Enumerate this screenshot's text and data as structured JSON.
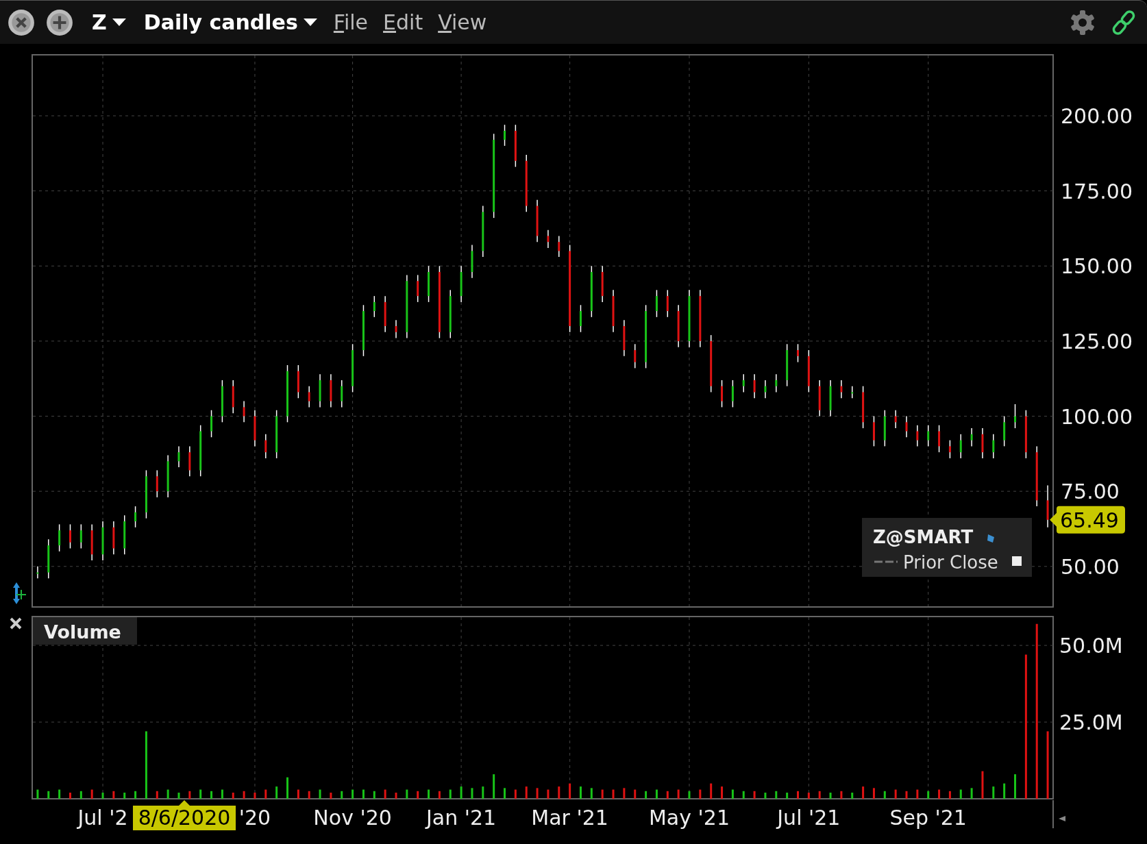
{
  "toolbar": {
    "symbol": "Z",
    "chart_type": "Daily candles",
    "menu": [
      "File",
      "Edit",
      "View"
    ]
  },
  "price_panel": {
    "legend": {
      "symbol": "Z@SMART",
      "prior_close_label": "Prior Close"
    },
    "last_price_tag": "65.49",
    "chart_data": {
      "type": "candlestick",
      "grid": true,
      "categories": [
        null,
        null,
        null,
        null,
        null,
        null,
        null,
        null,
        null,
        null,
        null,
        null,
        null,
        null,
        null,
        null,
        null,
        null,
        null,
        null,
        null,
        null,
        null,
        null,
        null,
        null,
        null,
        null,
        null,
        null,
        null,
        null,
        null,
        null,
        null,
        null,
        null,
        null,
        null,
        null,
        null,
        null,
        null,
        null,
        null,
        null,
        null,
        null,
        null,
        null,
        null,
        null,
        null,
        null,
        null,
        null,
        null,
        null,
        null,
        null,
        null,
        null,
        null,
        null,
        null,
        null,
        null,
        null,
        null,
        null,
        null,
        null,
        null,
        null,
        null,
        null,
        null,
        null,
        null,
        null,
        null,
        null,
        null,
        null,
        null,
        null,
        null,
        null,
        null,
        null,
        null,
        null,
        null,
        null
      ],
      "ohlc": [
        [
          48,
          50,
          46,
          48
        ],
        [
          48,
          59,
          46,
          57
        ],
        [
          57,
          64,
          55,
          62
        ],
        [
          62,
          64,
          56,
          58
        ],
        [
          58,
          64,
          56,
          62
        ],
        [
          62,
          64,
          52,
          54
        ],
        [
          54,
          65,
          52,
          63
        ],
        [
          63,
          65,
          54,
          56
        ],
        [
          56,
          67,
          54,
          65
        ],
        [
          65,
          70,
          63,
          68
        ],
        [
          68,
          82,
          66,
          80
        ],
        [
          80,
          82,
          73,
          75
        ],
        [
          75,
          87,
          73,
          85
        ],
        [
          85,
          90,
          83,
          88
        ],
        [
          88,
          90,
          80,
          82
        ],
        [
          82,
          97,
          80,
          95
        ],
        [
          95,
          102,
          93,
          100
        ],
        [
          100,
          112,
          98,
          110
        ],
        [
          110,
          112,
          101,
          103
        ],
        [
          103,
          105,
          98,
          100
        ],
        [
          100,
          102,
          90,
          92
        ],
        [
          92,
          94,
          86,
          88
        ],
        [
          88,
          102,
          86,
          100
        ],
        [
          100,
          117,
          98,
          115
        ],
        [
          115,
          117,
          106,
          108
        ],
        [
          108,
          110,
          103,
          105
        ],
        [
          105,
          114,
          103,
          112
        ],
        [
          112,
          114,
          103,
          105
        ],
        [
          105,
          112,
          103,
          110
        ],
        [
          110,
          124,
          108,
          122
        ],
        [
          122,
          137,
          120,
          135
        ],
        [
          135,
          140,
          133,
          138
        ],
        [
          138,
          140,
          128,
          130
        ],
        [
          130,
          132,
          126,
          128
        ],
        [
          128,
          147,
          126,
          145
        ],
        [
          145,
          147,
          138,
          140
        ],
        [
          140,
          150,
          138,
          148
        ],
        [
          148,
          150,
          126,
          128
        ],
        [
          128,
          142,
          126,
          140
        ],
        [
          140,
          150,
          138,
          148
        ],
        [
          148,
          157,
          146,
          155
        ],
        [
          155,
          170,
          153,
          168
        ],
        [
          168,
          194,
          166,
          192
        ],
        [
          192,
          197,
          190,
          195
        ],
        [
          195,
          197,
          183,
          185
        ],
        [
          185,
          187,
          168,
          170
        ],
        [
          170,
          172,
          158,
          160
        ],
        [
          160,
          162,
          156,
          158
        ],
        [
          158,
          160,
          153,
          155
        ],
        [
          155,
          157,
          128,
          130
        ],
        [
          130,
          137,
          128,
          135
        ],
        [
          135,
          150,
          133,
          148
        ],
        [
          148,
          150,
          138,
          140
        ],
        [
          140,
          142,
          128,
          130
        ],
        [
          130,
          132,
          120,
          122
        ],
        [
          122,
          124,
          116,
          118
        ],
        [
          118,
          137,
          116,
          135
        ],
        [
          135,
          142,
          133,
          140
        ],
        [
          140,
          142,
          133,
          135
        ],
        [
          135,
          137,
          123,
          125
        ],
        [
          125,
          142,
          123,
          140
        ],
        [
          140,
          142,
          123,
          125
        ],
        [
          125,
          127,
          108,
          110
        ],
        [
          110,
          112,
          103,
          105
        ],
        [
          105,
          112,
          103,
          110
        ],
        [
          110,
          114,
          108,
          112
        ],
        [
          112,
          114,
          106,
          108
        ],
        [
          108,
          112,
          106,
          110
        ],
        [
          110,
          114,
          108,
          112
        ],
        [
          112,
          124,
          110,
          122
        ],
        [
          122,
          124,
          118,
          120
        ],
        [
          120,
          122,
          108,
          110
        ],
        [
          110,
          112,
          100,
          102
        ],
        [
          102,
          112,
          100,
          110
        ],
        [
          110,
          112,
          106,
          108
        ],
        [
          108,
          110,
          106,
          108
        ],
        [
          108,
          110,
          96,
          98
        ],
        [
          98,
          100,
          90,
          92
        ],
        [
          92,
          102,
          90,
          100
        ],
        [
          100,
          102,
          96,
          98
        ],
        [
          98,
          100,
          93,
          95
        ],
        [
          95,
          97,
          90,
          92
        ],
        [
          92,
          97,
          90,
          95
        ],
        [
          95,
          97,
          88,
          90
        ],
        [
          90,
          92,
          86,
          88
        ],
        [
          88,
          94,
          86,
          92
        ],
        [
          92,
          96,
          90,
          94
        ],
        [
          94,
          96,
          86,
          88
        ],
        [
          88,
          94,
          86,
          92
        ],
        [
          92,
          100,
          90,
          98
        ],
        [
          98,
          104,
          96,
          100
        ],
        [
          100,
          102,
          86,
          88
        ],
        [
          88,
          90,
          70,
          72
        ],
        [
          72,
          77,
          63,
          65.5
        ]
      ],
      "ylim": [
        36.5,
        220.3
      ],
      "yticks": [
        {
          "value": 50,
          "label": "50.00"
        },
        {
          "value": 75,
          "label": "75.00"
        },
        {
          "value": 100,
          "label": "100.00"
        },
        {
          "value": 125,
          "label": "125.00"
        },
        {
          "value": 150,
          "label": "150.00"
        },
        {
          "value": 175,
          "label": "175.00"
        },
        {
          "value": 200,
          "label": "200.00"
        }
      ]
    }
  },
  "volume_panel": {
    "title": "Volume",
    "crosshair_date": "8/6/2020",
    "chart_data": {
      "type": "bar",
      "grid": true,
      "categories": [
        null,
        null,
        null,
        null,
        null,
        null,
        "Jul '2",
        null,
        null,
        null,
        null,
        null,
        null,
        null,
        null,
        null,
        null,
        null,
        null,
        null,
        "'20",
        null,
        null,
        null,
        null,
        null,
        null,
        null,
        null,
        "Nov '20",
        null,
        null,
        null,
        null,
        null,
        null,
        null,
        null,
        null,
        "Jan '21",
        null,
        null,
        null,
        null,
        null,
        null,
        null,
        null,
        null,
        "Mar '21",
        null,
        null,
        null,
        null,
        null,
        null,
        null,
        null,
        null,
        null,
        "May '21",
        null,
        null,
        null,
        null,
        null,
        null,
        null,
        null,
        null,
        null,
        "Jul '21",
        null,
        null,
        null,
        null,
        null,
        null,
        null,
        null,
        null,
        null,
        "Sep '21",
        null,
        null,
        null,
        null,
        null,
        null,
        null,
        null,
        null,
        null,
        null
      ],
      "values": [
        3,
        2.5,
        3,
        2,
        2.5,
        3,
        2,
        2.5,
        2,
        2.5,
        22,
        2.5,
        3,
        2,
        2.5,
        3,
        2.5,
        3,
        2,
        2.5,
        2,
        3,
        4,
        7,
        3,
        2.5,
        3,
        2,
        2.5,
        3,
        3,
        2.5,
        3,
        2,
        3,
        2.5,
        3,
        2.5,
        3,
        4,
        3.5,
        4,
        8,
        3.5,
        3,
        4,
        3.5,
        3,
        4,
        5,
        4,
        3.5,
        3,
        3,
        3.5,
        3,
        2.5,
        3,
        2.5,
        3,
        2.5,
        3,
        5,
        4,
        3,
        2.5,
        2.5,
        2,
        2.5,
        2,
        2.5,
        2,
        2.5,
        2,
        2.5,
        2,
        4,
        3.5,
        2.5,
        3,
        2.5,
        3,
        2.5,
        3,
        2.5,
        3,
        3.5,
        9,
        4,
        5,
        8,
        47,
        57,
        22
      ],
      "ylim": [
        0,
        59.4
      ],
      "yticks": [
        {
          "value": 25,
          "label": "25.0M"
        },
        {
          "value": 50,
          "label": "50.0M"
        }
      ]
    }
  }
}
